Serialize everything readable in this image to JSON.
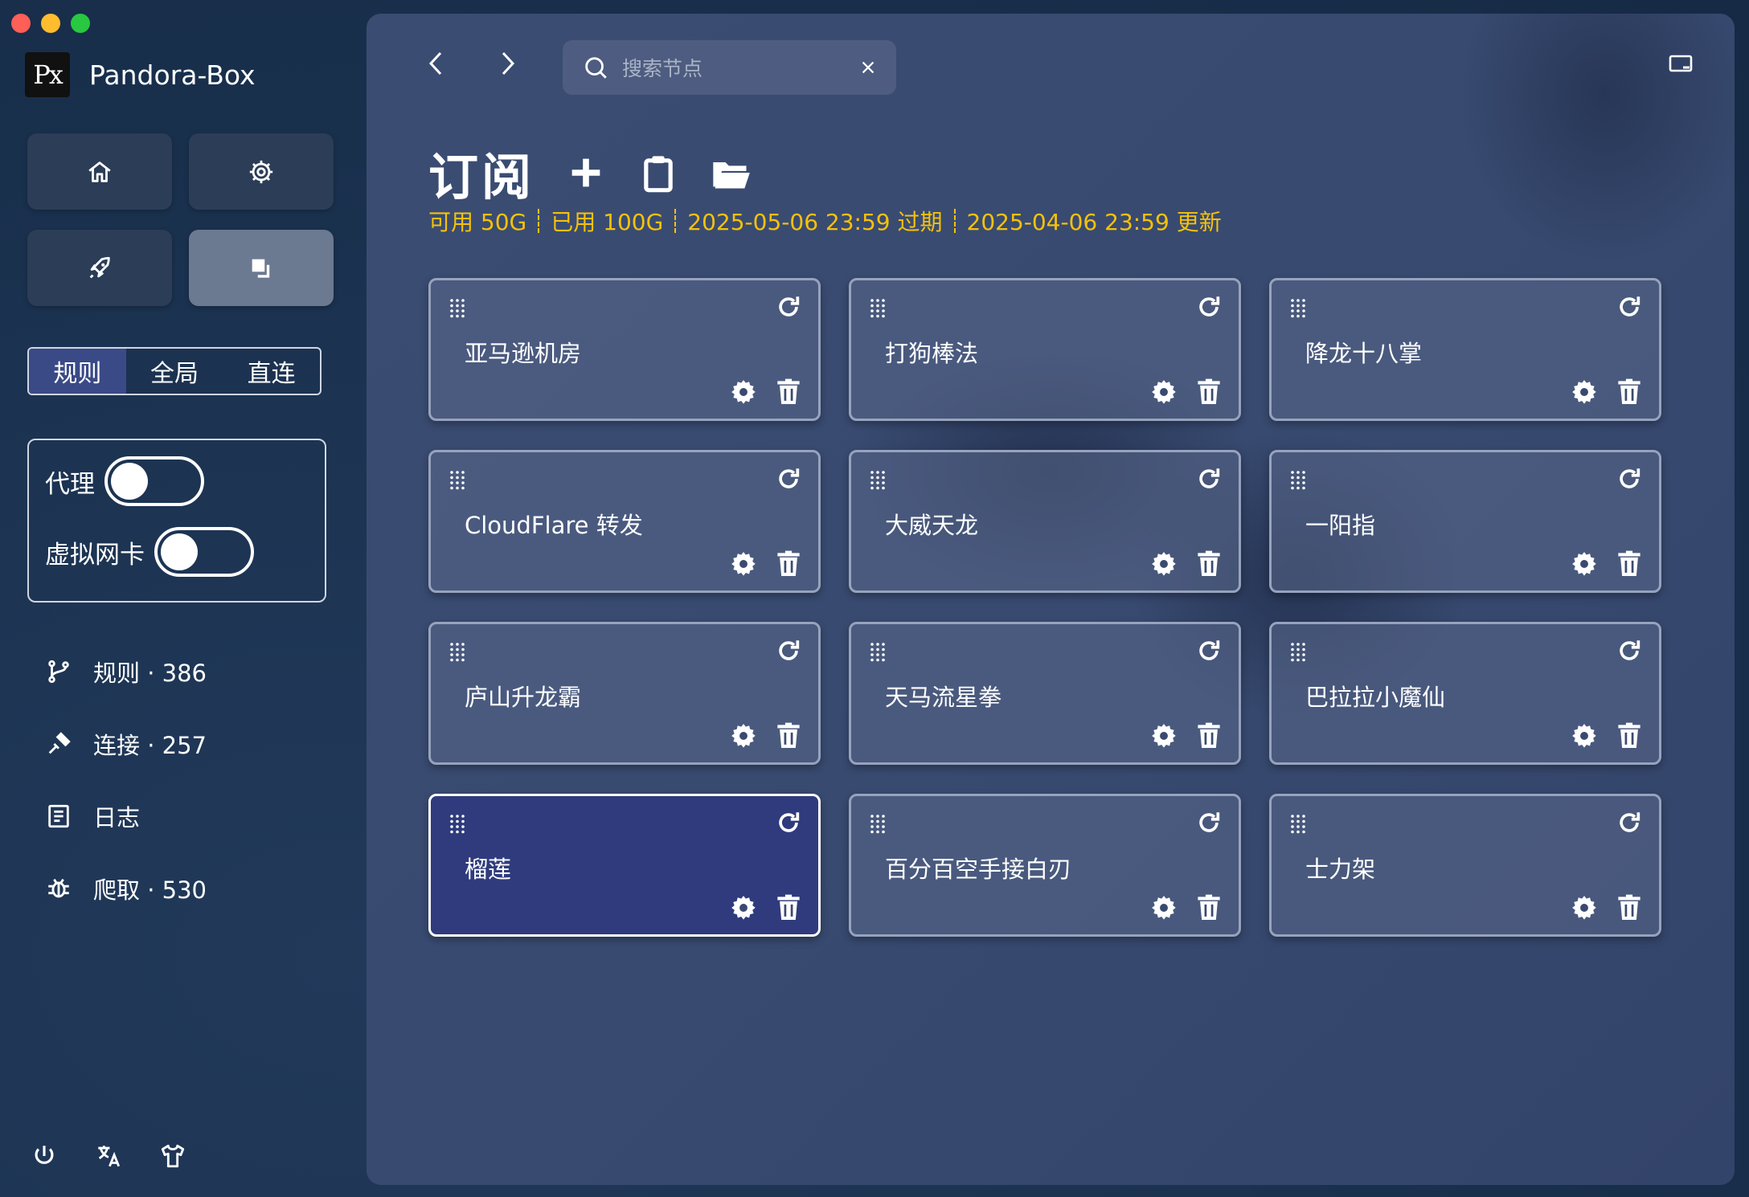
{
  "app": {
    "name": "Pandora-Box",
    "logo_text": "Px"
  },
  "sidebar": {
    "mode_tabs": [
      "规则",
      "全局",
      "直连"
    ],
    "selected_mode": "规则",
    "switches": [
      {
        "label": "代理",
        "on": false
      },
      {
        "label": "虚拟网卡",
        "on": false
      }
    ],
    "items": [
      {
        "label": "规则 · 386",
        "icon": "branch-icon"
      },
      {
        "label": "连接 · 257",
        "icon": "plug-icon"
      },
      {
        "label": "日志",
        "icon": "log-icon"
      },
      {
        "label": "爬取 · 530",
        "icon": "bug-icon"
      }
    ]
  },
  "search": {
    "placeholder": "搜索节点"
  },
  "page": {
    "title": "订阅",
    "available": "可用 50G",
    "used": "已用 100G",
    "expire": "2025-05-06 23:59 过期",
    "updated": "2025-04-06 23:59 更新"
  },
  "cards": [
    "亚马逊机房",
    "打狗棒法",
    "降龙十八掌",
    "CloudFlare 转发",
    "大威天龙",
    "一阳指",
    "庐山升龙霸",
    "天马流星拳",
    "巴拉拉小魔仙",
    "榴莲",
    "百分百空手接白刃",
    "士力架"
  ],
  "active_card": "榴莲",
  "colors": {
    "accent": "#3a4a87",
    "highlight": "#f5c20a",
    "active_card": "#2f3b7d"
  }
}
